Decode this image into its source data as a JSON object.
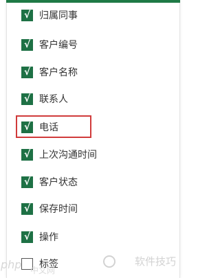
{
  "menu": {
    "items": [
      {
        "label": "归属同事",
        "checked": true
      },
      {
        "label": "客户编号",
        "checked": true
      },
      {
        "label": "客户名称",
        "checked": true
      },
      {
        "label": "联系人",
        "checked": true
      },
      {
        "label": "电话",
        "checked": true
      },
      {
        "label": "上次沟通时间",
        "checked": true
      },
      {
        "label": "客户状态",
        "checked": true
      },
      {
        "label": "保存时间",
        "checked": true
      },
      {
        "label": "操作",
        "checked": true
      },
      {
        "label": "标签",
        "checked": false
      }
    ],
    "check_glyph": "√",
    "highlighted_index": 4
  },
  "watermark": {
    "php": "php",
    "cn": "中文网",
    "brand": "软件技巧"
  },
  "colors": {
    "accent": "#1e7145",
    "highlight": "#d03a3a"
  }
}
